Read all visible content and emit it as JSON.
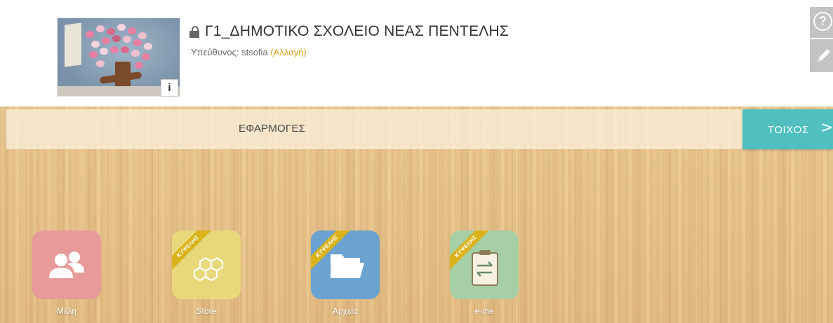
{
  "header": {
    "title": "Γ1_ΔΗΜΟΤΙΚΟ ΣΧΟΛΕΙΟ ΝΕΑΣ ΠΕΝΤΕΛΗΣ",
    "owner_label": "Υπεύθυνος: stsofia",
    "owner_change": "(Αλλαγή)",
    "info_badge": "i",
    "help_symbol": "?"
  },
  "tabs": {
    "apps": "ΕΦΑΡΜΟΓΕΣ",
    "wall": "ΤΟΙΧΟΣ",
    "wall_chevron": ">"
  },
  "apps": [
    {
      "label": "Μέλη",
      "icon": "members-icon",
      "color": "#e89a9a"
    },
    {
      "label": "Store",
      "icon": "hexagons-icon",
      "color": "#e8d87a",
      "ribbon": "ΚΥΨΕΛΗΣ"
    },
    {
      "label": "Αρχεία",
      "icon": "folder-icon",
      "color": "#6aa2d0",
      "ribbon": "ΚΥΨΕΛΗΣ"
    },
    {
      "label": "e-me",
      "icon": "exchange-icon",
      "color": "#a7cfa6",
      "ribbon": "ΚΥΨΕΛΗΣ"
    }
  ],
  "colors": {
    "accent_teal": "#4fbfbf",
    "link_orange": "#e0a020",
    "ribbon_gold": "#d9b21a"
  }
}
